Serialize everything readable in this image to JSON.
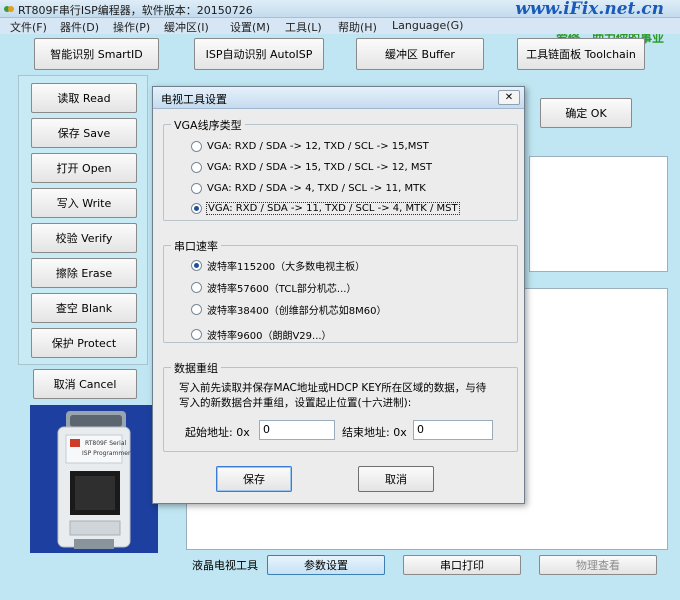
{
  "window": {
    "title": "RT809F串行ISP编程器，软件版本：20150726",
    "watermark_url": "www.iFix.net.cn",
    "watermark_slogan": "爱修，助力你的事业"
  },
  "menu": [
    "文件(F)",
    "器件(D)",
    "操作(P)",
    "缓冲区(I)",
    "设置(M)",
    "工具(L)",
    "帮助(H)",
    "Language(G)"
  ],
  "toolbar": {
    "smart_id": "智能识别 SmartID",
    "isp_auto": "ISP自动识别 AutoISP",
    "buffer": "缓冲区 Buffer",
    "toolchain": "工具链面板 Toolchain"
  },
  "left_buttons": [
    "读取 Read",
    "保存 Save",
    "打开 Open",
    "写入 Write",
    "校验 Verify",
    "擦除 Erase",
    "查空 Blank",
    "保护 Protect"
  ],
  "cancel_button": "取消 Cancel",
  "ok_button": "确定 OK",
  "chip": {
    "brand": "RT809F Serial",
    "model": "ISP Programmer"
  },
  "bottom": {
    "label": "液晶电视工具",
    "tabs": [
      "参数设置",
      "串口打印",
      "物理查看"
    ]
  },
  "dialog": {
    "title": "电视工具设置",
    "close": "✕",
    "vga_group": {
      "title": "VGA线序类型",
      "options": [
        "VGA: RXD / SDA -> 12, TXD / SCL -> 15,MST",
        "VGA: RXD / SDA -> 15, TXD / SCL -> 12, MST",
        "VGA: RXD / SDA ->  4, TXD / SCL -> 11, MTK",
        "VGA: RXD / SDA -> 11, TXD / SCL ->  4, MTK / MST"
      ],
      "selected_index": 3
    },
    "baud_group": {
      "title": "串口速率",
      "options": [
        "波特率115200（大多数电视主板）",
        "波特率57600（TCL部分机芯...）",
        "波特率38400（创维部分机芯如8M60）",
        "波特率9600（朗朗V29...）"
      ],
      "selected_index": 0
    },
    "data_group": {
      "title": "数据重组",
      "description_line1": "写入前先读取并保存MAC地址或HDCP KEY所在区域的数据，与待",
      "description_line2": "写入的新数据合并重组，设置起止位置(十六进制):",
      "start_label": "起始地址: 0x",
      "start_value": "0",
      "end_label": "结束地址: 0x",
      "end_value": "0"
    },
    "save_button": "保存",
    "cancel_button": "取消"
  }
}
